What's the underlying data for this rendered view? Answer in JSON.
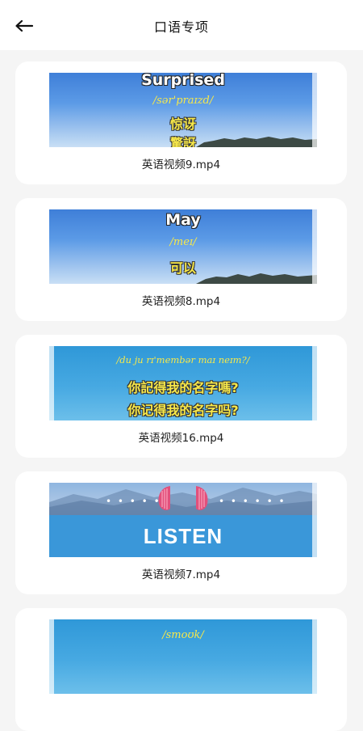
{
  "header": {
    "title": "口语专项"
  },
  "videos": [
    {
      "filename": "英语视频9.mp4",
      "word": "Surprised",
      "ipa": "/sər'praɪzd/",
      "cn1": "惊讶",
      "cn2": "驚訝"
    },
    {
      "filename": "英语视频8.mp4",
      "word": "May",
      "ipa": "/meɪ/",
      "cn1": "可以"
    },
    {
      "filename": "英语视频16.mp4",
      "ipa": "/du ju rɪ'membər maɪ neɪm?/",
      "cn1": "你記得我的名字嗎?",
      "cn2": "你记得我的名字吗?"
    },
    {
      "filename": "英语视频7.mp4",
      "word": "LISTEN"
    },
    {
      "ipa": "/smoʊk/"
    }
  ]
}
